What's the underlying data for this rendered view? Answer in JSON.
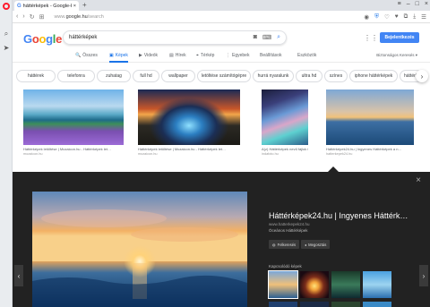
{
  "browser": {
    "tab_title": "háttérképek - Google-kere…",
    "address_prefix": "www.",
    "address_domain": "google.hu",
    "address_path": "/search"
  },
  "google": {
    "logo_letters": [
      "G",
      "o",
      "o",
      "g",
      "l",
      "e"
    ],
    "search_value": "háttérképek",
    "signin_label": "Bejelentkezés",
    "safesearch_label": "Biztonságos Keresés ▾",
    "nav_tabs": [
      {
        "label": "Összes",
        "icon": "🔍"
      },
      {
        "label": "Képek",
        "icon": "▣"
      },
      {
        "label": "Videók",
        "icon": "▶"
      },
      {
        "label": "Hírek",
        "icon": "▤"
      },
      {
        "label": "Térkép",
        "icon": "⌖"
      },
      {
        "label": "Egyebek",
        "icon": "⋮"
      },
      {
        "label": "Beállítások",
        "icon": ""
      },
      {
        "label": "Eszközök",
        "icon": ""
      }
    ],
    "chips": [
      "háttérek",
      "telefonra",
      "zuhatag",
      "full hd",
      "wallpaper",
      "letöltése számítógépre",
      "hurrá nyaralunk",
      "ultra hd",
      "színes",
      "iphone háttérképek",
      "háttérkép"
    ]
  },
  "thumbnails": [
    {
      "caption": "Háttérképek letöltése | Mozaicon.hu - Háttérképek let…",
      "source": "mozaicon.hu"
    },
    {
      "caption": "Háttérképek letöltése | Mozaicon.hu - Háttérképek let…",
      "source": "mozaicon.hu"
    },
    {
      "caption": "A(z) Háttérképek nevű fájlok f…",
      "source": "indafoto.hu"
    },
    {
      "caption": "Háttérképek24.hu | Ingyenes Háttérképek a n…",
      "source": "hatterkepek24.hu"
    }
  ],
  "preview": {
    "title": "Háttérképek24.hu | Ingyenes Háttérk…",
    "url": "www.hatterkepek24.hu",
    "subtitle": "Óceános Háttérképek",
    "visit_label": "Felkeresés",
    "share_label": "Megosztás",
    "related_label": "Kapcsolódó képek",
    "close_icon": "×",
    "prev_icon": "‹",
    "next_icon": "›"
  },
  "colors": {
    "accent": "#4285f4",
    "active_tab": "#1a73e8",
    "preview_bg": "#222222"
  }
}
